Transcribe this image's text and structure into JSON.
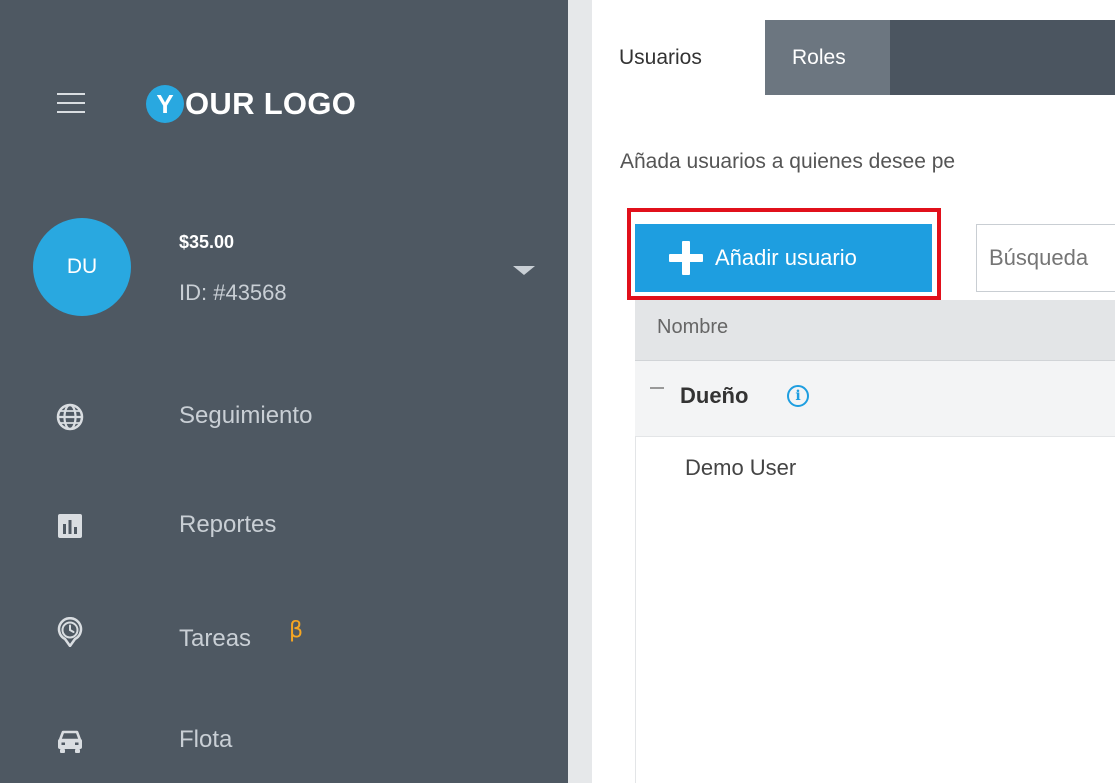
{
  "header": {
    "logo_initial": "Y",
    "logo_text": "OUR LOGO"
  },
  "account": {
    "initials": "DU",
    "balance": "$35.00",
    "id": "ID: #43568"
  },
  "sidebar": {
    "items": [
      {
        "label": "Seguimiento",
        "icon": "globe-icon"
      },
      {
        "label": "Reportes",
        "icon": "bar-chart-icon"
      },
      {
        "label": "Tareas",
        "icon": "clock-pin-icon",
        "badge": "β"
      },
      {
        "label": "Flota",
        "icon": "car-icon"
      }
    ]
  },
  "tabs": {
    "users": "Usuarios",
    "roles": "Roles"
  },
  "main": {
    "description": "Añada usuarios a quienes desee pe",
    "add_button": "Añadir usuario",
    "search_placeholder": "Búsqueda",
    "table": {
      "columns": [
        "Nombre"
      ],
      "groups": [
        {
          "name": "Dueño",
          "users": [
            "Demo User"
          ]
        }
      ]
    }
  },
  "colors": {
    "sidebar": "#4e5862",
    "accent": "#1e9ee0",
    "highlight": "#e1101b",
    "beta": "#f5a623"
  }
}
